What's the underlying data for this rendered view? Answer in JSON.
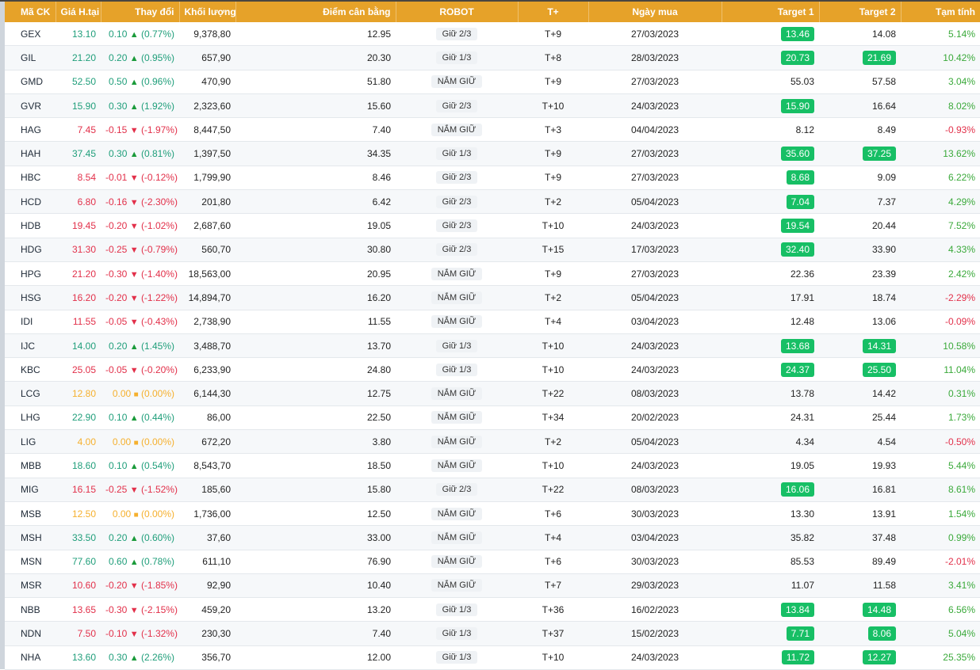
{
  "headers": [
    "Mã CK",
    "Giá H.tại",
    "Thay đổi",
    "Khối lượng",
    "Điểm cân bằng",
    "ROBOT",
    "T+",
    "Ngày mua",
    "Target 1",
    "Target 2",
    "Tạm tính"
  ],
  "colors": {
    "header": "#e6a229",
    "up": "#1f9e7a",
    "down": "#e2304a",
    "ref": "#f5b02e",
    "target_hit": "#17bf65"
  },
  "rows": [
    {
      "code": "GEX",
      "price": "13.10",
      "change": "0.10",
      "pct": "(0.77%)",
      "dir": "up",
      "volume": "9,378,80",
      "balance": "12.95",
      "robot": "Giữ 2/3",
      "t": "T+9",
      "date": "27/03/2023",
      "t1": "13.46",
      "t1_hit": true,
      "t2": "14.08",
      "t2_hit": false,
      "est": "5.14%"
    },
    {
      "code": "GIL",
      "price": "21.20",
      "change": "0.20",
      "pct": "(0.95%)",
      "dir": "up",
      "volume": "657,90",
      "balance": "20.30",
      "robot": "Giữ 1/3",
      "t": "T+8",
      "date": "28/03/2023",
      "t1": "20.73",
      "t1_hit": true,
      "t2": "21.69",
      "t2_hit": true,
      "est": "10.42%"
    },
    {
      "code": "GMD",
      "price": "52.50",
      "change": "0.50",
      "pct": "(0.96%)",
      "dir": "up",
      "volume": "470,90",
      "balance": "51.80",
      "robot": "NẮM GIỮ",
      "t": "T+9",
      "date": "27/03/2023",
      "t1": "55.03",
      "t1_hit": false,
      "t2": "57.58",
      "t2_hit": false,
      "est": "3.04%"
    },
    {
      "code": "GVR",
      "price": "15.90",
      "change": "0.30",
      "pct": "(1.92%)",
      "dir": "up",
      "volume": "2,323,60",
      "balance": "15.60",
      "robot": "Giữ 2/3",
      "t": "T+10",
      "date": "24/03/2023",
      "t1": "15.90",
      "t1_hit": true,
      "t2": "16.64",
      "t2_hit": false,
      "est": "8.02%"
    },
    {
      "code": "HAG",
      "price": "7.45",
      "change": "-0.15",
      "pct": "(-1.97%)",
      "dir": "down",
      "volume": "8,447,50",
      "balance": "7.40",
      "robot": "NẮM GIỮ",
      "t": "T+3",
      "date": "04/04/2023",
      "t1": "8.12",
      "t1_hit": false,
      "t2": "8.49",
      "t2_hit": false,
      "est": "-0.93%"
    },
    {
      "code": "HAH",
      "price": "37.45",
      "change": "0.30",
      "pct": "(0.81%)",
      "dir": "up",
      "volume": "1,397,50",
      "balance": "34.35",
      "robot": "Giữ 1/3",
      "t": "T+9",
      "date": "27/03/2023",
      "t1": "35.60",
      "t1_hit": true,
      "t2": "37.25",
      "t2_hit": true,
      "est": "13.62%"
    },
    {
      "code": "HBC",
      "price": "8.54",
      "change": "-0.01",
      "pct": "(-0.12%)",
      "dir": "down",
      "volume": "1,799,90",
      "balance": "8.46",
      "robot": "Giữ 2/3",
      "t": "T+9",
      "date": "27/03/2023",
      "t1": "8.68",
      "t1_hit": true,
      "t2": "9.09",
      "t2_hit": false,
      "est": "6.22%"
    },
    {
      "code": "HCD",
      "price": "6.80",
      "change": "-0.16",
      "pct": "(-2.30%)",
      "dir": "down",
      "volume": "201,80",
      "balance": "6.42",
      "robot": "Giữ 2/3",
      "t": "T+2",
      "date": "05/04/2023",
      "t1": "7.04",
      "t1_hit": true,
      "t2": "7.37",
      "t2_hit": false,
      "est": "4.29%"
    },
    {
      "code": "HDB",
      "price": "19.45",
      "change": "-0.20",
      "pct": "(-1.02%)",
      "dir": "down",
      "volume": "2,687,60",
      "balance": "19.05",
      "robot": "Giữ 2/3",
      "t": "T+10",
      "date": "24/03/2023",
      "t1": "19.54",
      "t1_hit": true,
      "t2": "20.44",
      "t2_hit": false,
      "est": "7.52%"
    },
    {
      "code": "HDG",
      "price": "31.30",
      "change": "-0.25",
      "pct": "(-0.79%)",
      "dir": "down",
      "volume": "560,70",
      "balance": "30.80",
      "robot": "Giữ 2/3",
      "t": "T+15",
      "date": "17/03/2023",
      "t1": "32.40",
      "t1_hit": true,
      "t2": "33.90",
      "t2_hit": false,
      "est": "4.33%"
    },
    {
      "code": "HPG",
      "price": "21.20",
      "change": "-0.30",
      "pct": "(-1.40%)",
      "dir": "down",
      "volume": "18,563,00",
      "balance": "20.95",
      "robot": "NẮM GIỮ",
      "t": "T+9",
      "date": "27/03/2023",
      "t1": "22.36",
      "t1_hit": false,
      "t2": "23.39",
      "t2_hit": false,
      "est": "2.42%"
    },
    {
      "code": "HSG",
      "price": "16.20",
      "change": "-0.20",
      "pct": "(-1.22%)",
      "dir": "down",
      "volume": "14,894,70",
      "balance": "16.20",
      "robot": "NẮM GIỮ",
      "t": "T+2",
      "date": "05/04/2023",
      "t1": "17.91",
      "t1_hit": false,
      "t2": "18.74",
      "t2_hit": false,
      "est": "-2.29%"
    },
    {
      "code": "IDI",
      "price": "11.55",
      "change": "-0.05",
      "pct": "(-0.43%)",
      "dir": "down",
      "volume": "2,738,90",
      "balance": "11.55",
      "robot": "NẮM GIỮ",
      "t": "T+4",
      "date": "03/04/2023",
      "t1": "12.48",
      "t1_hit": false,
      "t2": "13.06",
      "t2_hit": false,
      "est": "-0.09%"
    },
    {
      "code": "IJC",
      "price": "14.00",
      "change": "0.20",
      "pct": "(1.45%)",
      "dir": "up",
      "volume": "3,488,70",
      "balance": "13.70",
      "robot": "Giữ 1/3",
      "t": "T+10",
      "date": "24/03/2023",
      "t1": "13.68",
      "t1_hit": true,
      "t2": "14.31",
      "t2_hit": true,
      "est": "10.58%"
    },
    {
      "code": "KBC",
      "price": "25.05",
      "change": "-0.05",
      "pct": "(-0.20%)",
      "dir": "down",
      "volume": "6,233,90",
      "balance": "24.80",
      "robot": "Giữ 1/3",
      "t": "T+10",
      "date": "24/03/2023",
      "t1": "24.37",
      "t1_hit": true,
      "t2": "25.50",
      "t2_hit": true,
      "est": "11.04%"
    },
    {
      "code": "LCG",
      "price": "12.80",
      "change": "0.00",
      "pct": "(0.00%)",
      "dir": "ref",
      "volume": "6,144,30",
      "balance": "12.75",
      "robot": "NẮM GIỮ",
      "t": "T+22",
      "date": "08/03/2023",
      "t1": "13.78",
      "t1_hit": false,
      "t2": "14.42",
      "t2_hit": false,
      "est": "0.31%"
    },
    {
      "code": "LHG",
      "price": "22.90",
      "change": "0.10",
      "pct": "(0.44%)",
      "dir": "up",
      "volume": "86,00",
      "balance": "22.50",
      "robot": "NẮM GIỮ",
      "t": "T+34",
      "date": "20/02/2023",
      "t1": "24.31",
      "t1_hit": false,
      "t2": "25.44",
      "t2_hit": false,
      "est": "1.73%"
    },
    {
      "code": "LIG",
      "price": "4.00",
      "change": "0.00",
      "pct": "(0.00%)",
      "dir": "ref",
      "volume": "672,20",
      "balance": "3.80",
      "robot": "NẮM GIỮ",
      "t": "T+2",
      "date": "05/04/2023",
      "t1": "4.34",
      "t1_hit": false,
      "t2": "4.54",
      "t2_hit": false,
      "est": "-0.50%"
    },
    {
      "code": "MBB",
      "price": "18.60",
      "change": "0.10",
      "pct": "(0.54%)",
      "dir": "up",
      "volume": "8,543,70",
      "balance": "18.50",
      "robot": "NẮM GIỮ",
      "t": "T+10",
      "date": "24/03/2023",
      "t1": "19.05",
      "t1_hit": false,
      "t2": "19.93",
      "t2_hit": false,
      "est": "5.44%"
    },
    {
      "code": "MIG",
      "price": "16.15",
      "change": "-0.25",
      "pct": "(-1.52%)",
      "dir": "down",
      "volume": "185,60",
      "balance": "15.80",
      "robot": "Giữ 2/3",
      "t": "T+22",
      "date": "08/03/2023",
      "t1": "16.06",
      "t1_hit": true,
      "t2": "16.81",
      "t2_hit": false,
      "est": "8.61%"
    },
    {
      "code": "MSB",
      "price": "12.50",
      "change": "0.00",
      "pct": "(0.00%)",
      "dir": "ref",
      "volume": "1,736,00",
      "balance": "12.50",
      "robot": "NẮM GIỮ",
      "t": "T+6",
      "date": "30/03/2023",
      "t1": "13.30",
      "t1_hit": false,
      "t2": "13.91",
      "t2_hit": false,
      "est": "1.54%"
    },
    {
      "code": "MSH",
      "price": "33.50",
      "change": "0.20",
      "pct": "(0.60%)",
      "dir": "up",
      "volume": "37,60",
      "balance": "33.00",
      "robot": "NẮM GIỮ",
      "t": "T+4",
      "date": "03/04/2023",
      "t1": "35.82",
      "t1_hit": false,
      "t2": "37.48",
      "t2_hit": false,
      "est": "0.99%"
    },
    {
      "code": "MSN",
      "price": "77.60",
      "change": "0.60",
      "pct": "(0.78%)",
      "dir": "up",
      "volume": "611,10",
      "balance": "76.90",
      "robot": "NẮM GIỮ",
      "t": "T+6",
      "date": "30/03/2023",
      "t1": "85.53",
      "t1_hit": false,
      "t2": "89.49",
      "t2_hit": false,
      "est": "-2.01%"
    },
    {
      "code": "MSR",
      "price": "10.60",
      "change": "-0.20",
      "pct": "(-1.85%)",
      "dir": "down",
      "volume": "92,90",
      "balance": "10.40",
      "robot": "NẮM GIỮ",
      "t": "T+7",
      "date": "29/03/2023",
      "t1": "11.07",
      "t1_hit": false,
      "t2": "11.58",
      "t2_hit": false,
      "est": "3.41%"
    },
    {
      "code": "NBB",
      "price": "13.65",
      "change": "-0.30",
      "pct": "(-2.15%)",
      "dir": "down",
      "volume": "459,20",
      "balance": "13.20",
      "robot": "Giữ 1/3",
      "t": "T+36",
      "date": "16/02/2023",
      "t1": "13.84",
      "t1_hit": true,
      "t2": "14.48",
      "t2_hit": true,
      "est": "6.56%"
    },
    {
      "code": "NDN",
      "price": "7.50",
      "change": "-0.10",
      "pct": "(-1.32%)",
      "dir": "down",
      "volume": "230,30",
      "balance": "7.40",
      "robot": "Giữ 1/3",
      "t": "T+37",
      "date": "15/02/2023",
      "t1": "7.71",
      "t1_hit": true,
      "t2": "8.06",
      "t2_hit": true,
      "est": "5.04%"
    },
    {
      "code": "NHA",
      "price": "13.60",
      "change": "0.30",
      "pct": "(2.26%)",
      "dir": "up",
      "volume": "356,70",
      "balance": "12.00",
      "robot": "Giữ 1/3",
      "t": "T+10",
      "date": "24/03/2023",
      "t1": "11.72",
      "t1_hit": true,
      "t2": "12.27",
      "t2_hit": true,
      "est": "25.35%"
    }
  ]
}
